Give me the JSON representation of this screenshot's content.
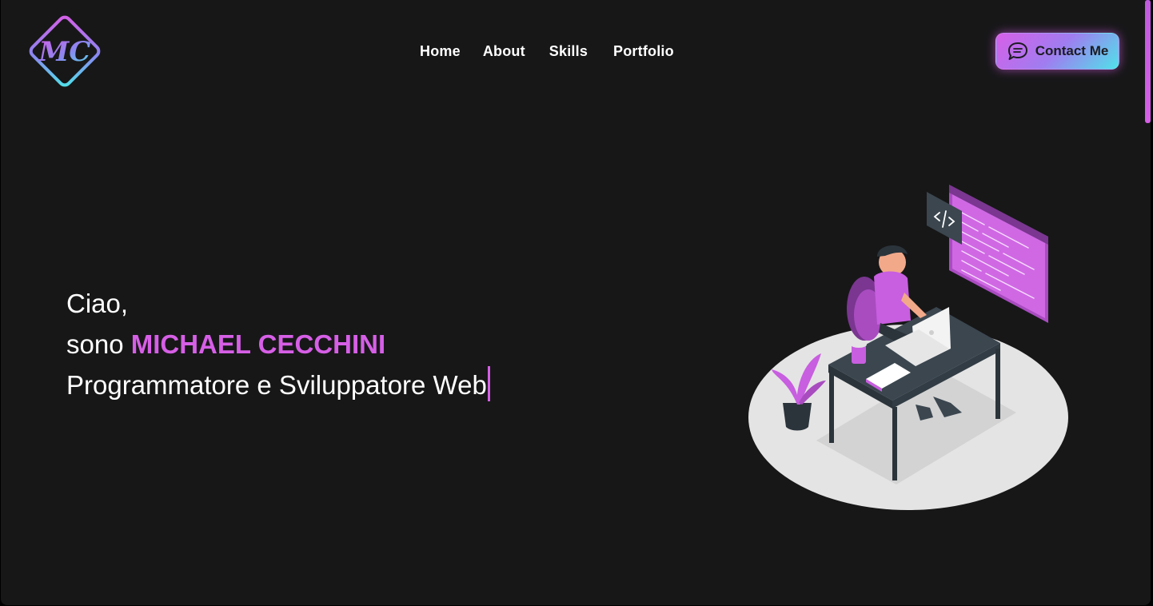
{
  "header": {
    "logo": {
      "text": "MC",
      "icon": "mc-logo-icon"
    },
    "nav": [
      {
        "label": "Home"
      },
      {
        "label": "About"
      },
      {
        "label": "Skills"
      },
      {
        "label": "Portfolio"
      }
    ],
    "contact_button": {
      "label": "Contact Me",
      "icon": "chat-bubble-icon"
    }
  },
  "hero": {
    "greeting": "Ciao,",
    "intro_prefix": "sono",
    "name": "MICHAEL CECCHINI",
    "role": "Programmatore e Sviluppatore Web"
  },
  "illustration": {
    "icon": "developer-at-desk-illustration"
  },
  "colors": {
    "background": "#171718",
    "accent_pink": "#d65fe6",
    "accent_cyan": "#4fe3e9",
    "text": "#ffffff"
  }
}
